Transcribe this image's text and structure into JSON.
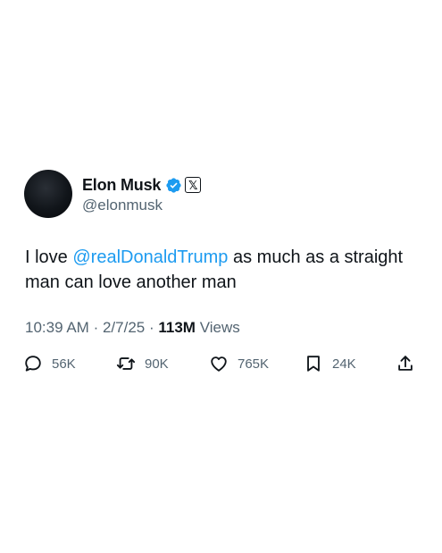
{
  "author": {
    "display_name": "Elon Musk",
    "handle": "@elonmusk",
    "verified": true,
    "affiliate_badge": "𝕏",
    "badge_color": "#1d9bf0"
  },
  "tweet": {
    "text_before": "I love ",
    "mention": "@realDonaldTrump",
    "text_after": " as much as a straight man can love another man",
    "mention_color": "#1d9bf0"
  },
  "meta": {
    "time": "10:39 AM",
    "separator": "·",
    "date": "2/7/25",
    "views_count": "113M",
    "views_label": "Views"
  },
  "actions": {
    "replies": "56K",
    "reposts": "90K",
    "likes": "765K",
    "bookmarks": "24K"
  }
}
